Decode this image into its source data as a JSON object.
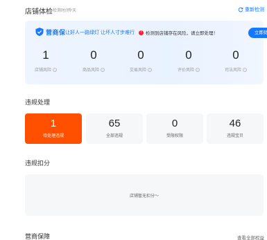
{
  "header": {
    "title": "店铺体检",
    "checked_label": "检测时间",
    "checked_time": "今天",
    "recheck_label": "重新检测"
  },
  "card": {
    "brand_name": "营商保",
    "slogan": "让好人一路绿灯 让坏人寸步难行",
    "warning": "检测到店铺存在风险，请立即处理！",
    "fix_button": "立即处理",
    "metrics": [
      {
        "value": "1",
        "label": "店铺风险"
      },
      {
        "value": "0",
        "label": "商品风险"
      },
      {
        "value": "0",
        "label": "交易风险"
      },
      {
        "value": "0",
        "label": "评价风险"
      },
      {
        "value": "0",
        "label": "司法风险"
      }
    ]
  },
  "violations": {
    "title": "违规处理",
    "boxes": [
      {
        "value": "1",
        "label": "待处理违规"
      },
      {
        "value": "65",
        "label": "全部违规"
      },
      {
        "value": "0",
        "label": "受限权限"
      },
      {
        "value": "46",
        "label": "违规宝贝"
      }
    ]
  },
  "deduction": {
    "title": "违规扣分",
    "empty_text": "店铺暂无扣分～"
  },
  "guarantee": {
    "title": "营商保障",
    "link": "查看全部权益"
  },
  "colors": {
    "accent": "#1677ff",
    "danger": "#f5222d",
    "orange": "#ff5000"
  }
}
